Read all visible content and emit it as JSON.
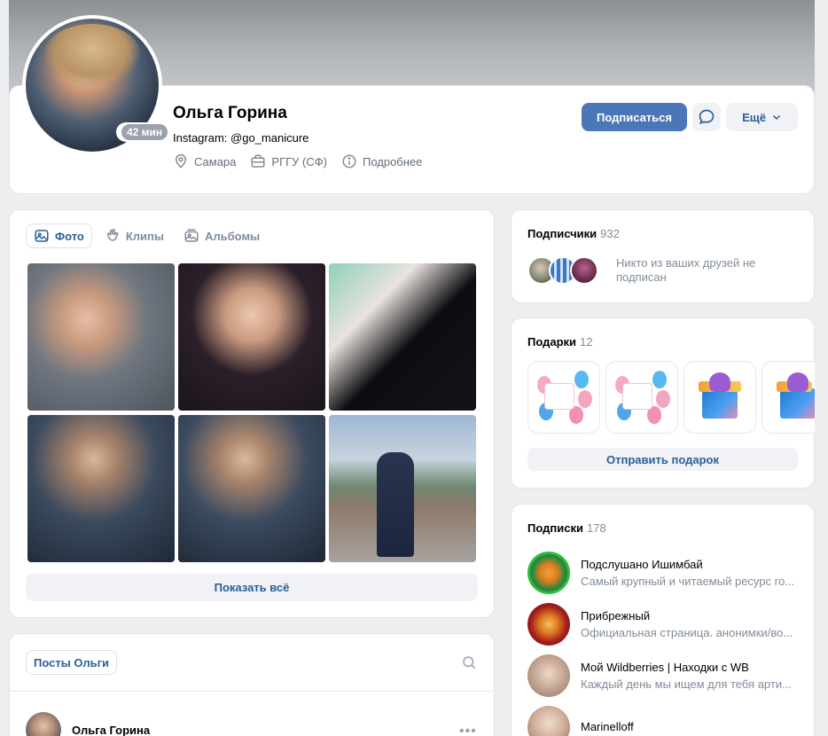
{
  "profile": {
    "name": "Ольга Горина",
    "status": "Instagram: @go_manicure",
    "online": "42 мин",
    "city": "Самара",
    "education": "РГГУ (СФ)",
    "details": "Подробнее",
    "subscribe_label": "Подписаться",
    "more_label": "Ещё"
  },
  "photos": {
    "tabs": [
      {
        "label": "Фото",
        "icon": "photo-icon",
        "active": true
      },
      {
        "label": "Клипы",
        "icon": "clips-icon",
        "active": false
      },
      {
        "label": "Альбомы",
        "icon": "albums-icon",
        "active": false
      }
    ],
    "show_all_label": "Показать всё"
  },
  "posts": {
    "tab_label": "Посты Ольги",
    "first_post_author": "Ольга Горина"
  },
  "subscribers": {
    "title": "Подписчики",
    "count": "932",
    "note": "Никто из ваших друзей не подписан"
  },
  "gifts": {
    "title": "Подарки",
    "count": "12",
    "send_label": "Отправить подарок"
  },
  "subscriptions": {
    "title": "Подписки",
    "count": "178",
    "items": [
      {
        "name": "Подслушано Ишимбай",
        "desc": "Самый крупный и читаемый ресурс го..."
      },
      {
        "name": "Прибрежный",
        "desc": "Официальная страница. анонимки/во..."
      },
      {
        "name": "Мой Wildberries | Находки с WB",
        "desc": "Каждый день мы ищем для тебя арти..."
      },
      {
        "name": "Marinelloff",
        "desc": ""
      }
    ]
  },
  "colors": {
    "accent": "#4b77b8",
    "link": "#2d5e9a",
    "background": "#edeef0",
    "muted": "#818c99"
  }
}
